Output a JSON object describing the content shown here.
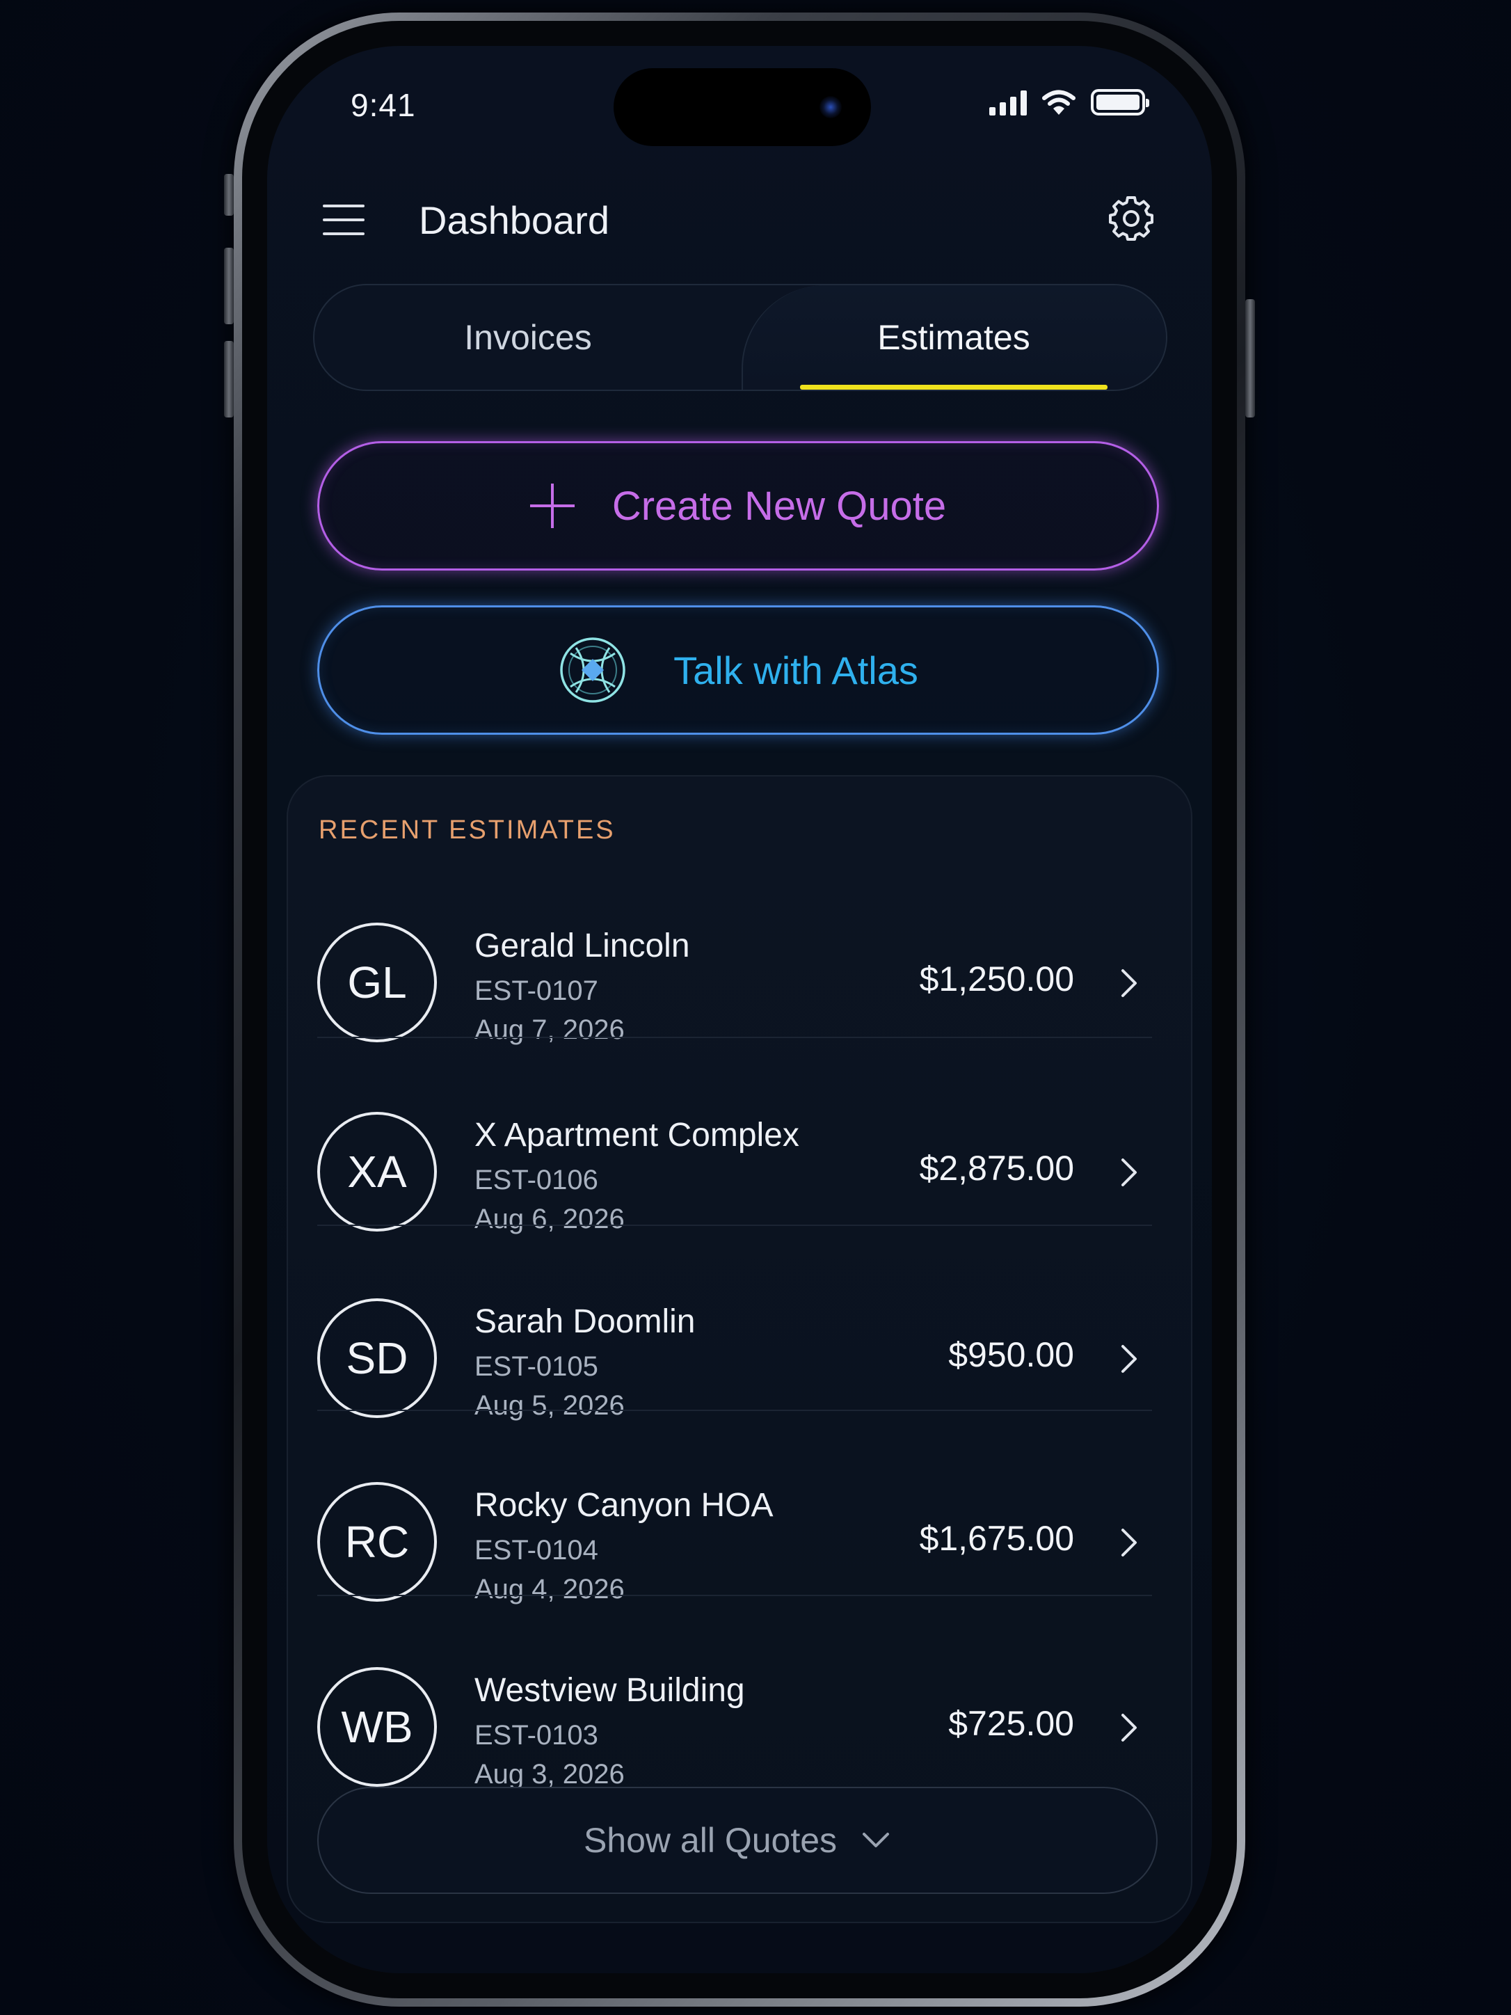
{
  "status_bar": {
    "time": "9:41"
  },
  "header": {
    "title": "Dashboard"
  },
  "tabs": [
    {
      "label": "Invoices",
      "active": false
    },
    {
      "label": "Estimates",
      "active": true
    }
  ],
  "actions": {
    "create_quote_label": "Create New Quote",
    "talk_atlas_label": "Talk with Atlas"
  },
  "recent": {
    "title": "RECENT ESTIMATES",
    "items": [
      {
        "initials": "GL",
        "name": "Gerald Lincoln",
        "id": "EST-0107",
        "date": "Aug 7, 2026",
        "amount": "$1,250.00"
      },
      {
        "initials": "XA",
        "name": "X Apartment Complex",
        "id": "EST-0106",
        "date": "Aug 6, 2026",
        "amount": "$2,875.00"
      },
      {
        "initials": "SD",
        "name": "Sarah Doomlin",
        "id": "EST-0105",
        "date": "Aug 5, 2026",
        "amount": "$950.00"
      },
      {
        "initials": "RC",
        "name": "Rocky Canyon HOA",
        "id": "EST-0104",
        "date": "Aug 4, 2026",
        "amount": "$1,675.00"
      },
      {
        "initials": "WB",
        "name": "Westview Building",
        "id": "EST-0103",
        "date": "Aug 3, 2026",
        "amount": "$725.00"
      }
    ],
    "show_all_label": "Show all Quotes"
  },
  "icons": {
    "menu": "hamburger-icon",
    "settings": "gear-icon",
    "plus": "plus-icon",
    "atlas": "atlas-logo-icon",
    "row_chevron": "chevron-right-icon",
    "show_all_chevron": "chevron-down-icon"
  },
  "colors": {
    "background": "#050a17",
    "tab_underline": "#f0e21d",
    "quote_accent": "#c66de8",
    "atlas_accent": "#2fb1ee",
    "section_title": "#e7a06e"
  }
}
